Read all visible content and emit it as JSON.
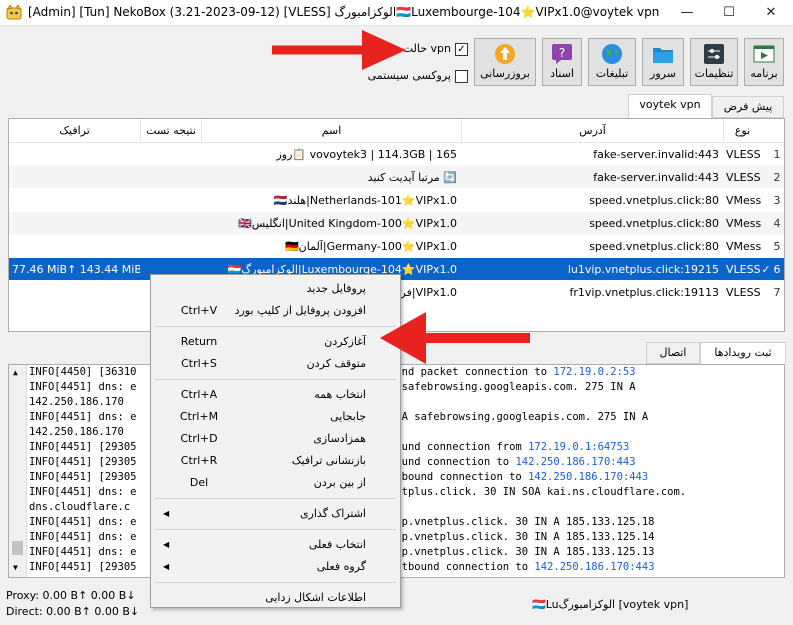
{
  "window": {
    "title": "[Admin] [Tun] NekoBox (3.21-2023-09-12) [VLESS] الوکزامبورگ🇱🇺Luxembourge-104⭐VIPx1.0@voytek vpn",
    "minimize": "—",
    "maximize": "☐",
    "close": "✕"
  },
  "toolbar": {
    "program": "برنامه",
    "settings": "تنظیمات",
    "server": "سرور",
    "ads": "تبلیغات",
    "docs": "اسناد",
    "update": "بروزرسانی",
    "vpn_mode_label": "حالت vpn",
    "vpn_mode_checked": true,
    "system_proxy_label": "پروکسی سیستمی",
    "system_proxy_checked": false
  },
  "tabs": [
    {
      "label": "پیش فرض",
      "active": false
    },
    {
      "label": "voytek vpn",
      "active": true
    }
  ],
  "table": {
    "headers": {
      "type": "نوع",
      "address": "آدرس",
      "name": "اسم",
      "test": "نتیجه تست",
      "traffic": "ترافیک"
    },
    "rows": [
      {
        "num": "1",
        "type": "VLESS",
        "address": "fake-server.invalid:443",
        "name": "vovoytek3 | 114.3GB | 165 📋روز",
        "traffic": "",
        "selected": false,
        "check": ""
      },
      {
        "num": "2",
        "type": "VLESS",
        "address": "fake-server.invalid:443",
        "name": "🔄 مرتبا آپدیت کنید",
        "traffic": "",
        "selected": false,
        "check": ""
      },
      {
        "num": "3",
        "type": "VMess",
        "address": "speed.vnetplus.click:80",
        "name": "Netherlands-101⭐VIPx1.0|هلند🇳🇱",
        "traffic": "",
        "selected": false,
        "check": ""
      },
      {
        "num": "4",
        "type": "VMess",
        "address": "speed.vnetplus.click:80",
        "name": "United Kingdom-100⭐VIPx1.0|انگلیس🇬🇧",
        "traffic": "",
        "selected": false,
        "check": ""
      },
      {
        "num": "5",
        "type": "VMess",
        "address": "speed.vnetplus.click:80",
        "name": "Germany-100⭐VIPx1.0|آلمان🇩🇪",
        "traffic": "",
        "selected": false,
        "check": ""
      },
      {
        "num": "6",
        "type": "VLESS",
        "address": "lu1vip.vnetplus.click:19215",
        "name": "Luxembourge-104⭐VIPx1.0|الوکزامبورگ🇱🇺",
        "traffic": "77.46 MiB↑ 143.44 MiB↓",
        "selected": true,
        "check": "✓"
      },
      {
        "num": "7",
        "type": "VLESS",
        "address": "fr1vip.vnetplus.click:19113",
        "name": "VIPx1.0|فرانسه🇫🇷",
        "traffic": "",
        "selected": false,
        "check": ""
      }
    ]
  },
  "log_tabs": [
    {
      "label": "ثبت رویدادها",
      "active": true
    },
    {
      "label": "اتصال",
      "active": false
    }
  ],
  "log_lines": [
    {
      "left": "INFO[4450] [36310",
      "right": "ound packet connection to ",
      "ip": "172.19.0.2:53"
    },
    {
      "left": "INFO[4451] dns: e",
      "right": "A safebrowsing.googleapis.com. 275 IN A",
      "ip": ""
    },
    {
      "left": "142.250.186.170",
      "right": "",
      "ip": ""
    },
    {
      "left": "INFO[4451] dns: e",
      "right": ". A safebrowsing.googleapis.com. 275 IN A",
      "ip": ""
    },
    {
      "left": "142.250.186.170",
      "right": "",
      "ip": ""
    },
    {
      "left": "INFO[4451] [29305",
      "right": "bound connection from ",
      "ip": "172.19.0.1:64753"
    },
    {
      "left": "INFO[4451] [29305",
      "right": "bound connection to ",
      "ip": "142.250.186.170:443"
    },
    {
      "left": "INFO[4451] [29305",
      "right": "utbound connection to ",
      "ip": "142.250.186.170:443"
    },
    {
      "left": "INFO[4451] dns: e",
      "right": "netplus.click. 30 IN SOA kai.ns.cloudflare.com.",
      "ip": ""
    },
    {
      "left": "dns.cloudflare.c",
      "right": "",
      "ip": ""
    },
    {
      "left": "INFO[4451] dns: e",
      "right": "vip.vnetplus.click. 30 IN A 185.133.125.18",
      "ip": ""
    },
    {
      "left": "INFO[4451] dns: e",
      "right": "vip.vnetplus.click. 30 IN A 185.133.125.14",
      "ip": ""
    },
    {
      "left": "INFO[4451] dns: e",
      "right": "vip.vnetplus.click. 30 IN A 185.133.125.13",
      "ip": ""
    },
    {
      "left": "INFO[4451] [29305",
      "right": "outbound connection to ",
      "ip": "142.250.186.170:443"
    }
  ],
  "status": {
    "proxy": "Proxy: 0.00 B↑ 0.00 B↓",
    "direct": "Direct: 0.00 B↑ 0.00 B↓",
    "active_profile": "[voytek vpn] الوکزامبورگ🇱🇺Lu"
  },
  "context_menu": [
    {
      "label": "پروفایل جدید",
      "shortcut": "",
      "submenu": false
    },
    {
      "label": "افزودن پروفایل از کلیپ بورد",
      "shortcut": "Ctrl+V",
      "submenu": false
    },
    {
      "sep": true
    },
    {
      "label": "آغازکردن",
      "shortcut": "Return",
      "submenu": false
    },
    {
      "label": "متوقف کردن",
      "shortcut": "Ctrl+S",
      "submenu": false
    },
    {
      "sep": true
    },
    {
      "label": "انتخاب همه",
      "shortcut": "Ctrl+A",
      "submenu": false
    },
    {
      "label": "جابجایی",
      "shortcut": "Ctrl+M",
      "submenu": false
    },
    {
      "label": "همزادسازی",
      "shortcut": "Ctrl+D",
      "submenu": false
    },
    {
      "label": "بازنشانی ترافیک",
      "shortcut": "Ctrl+R",
      "submenu": false
    },
    {
      "label": "از بین بردن",
      "shortcut": "Del",
      "submenu": false
    },
    {
      "sep": true
    },
    {
      "label": "اشتراک گذاری",
      "shortcut": "",
      "submenu": true
    },
    {
      "sep": true
    },
    {
      "label": "انتخاب فعلی",
      "shortcut": "",
      "submenu": true
    },
    {
      "label": "گروه فعلی",
      "shortcut": "",
      "submenu": true
    },
    {
      "sep": true
    },
    {
      "label": "اطلاعات اشکال زدایی",
      "shortcut": "",
      "submenu": false
    }
  ],
  "colors": {
    "selection": "#0a64c9",
    "arrow": "#e8231f",
    "log_ip": "#1a5fd6"
  }
}
